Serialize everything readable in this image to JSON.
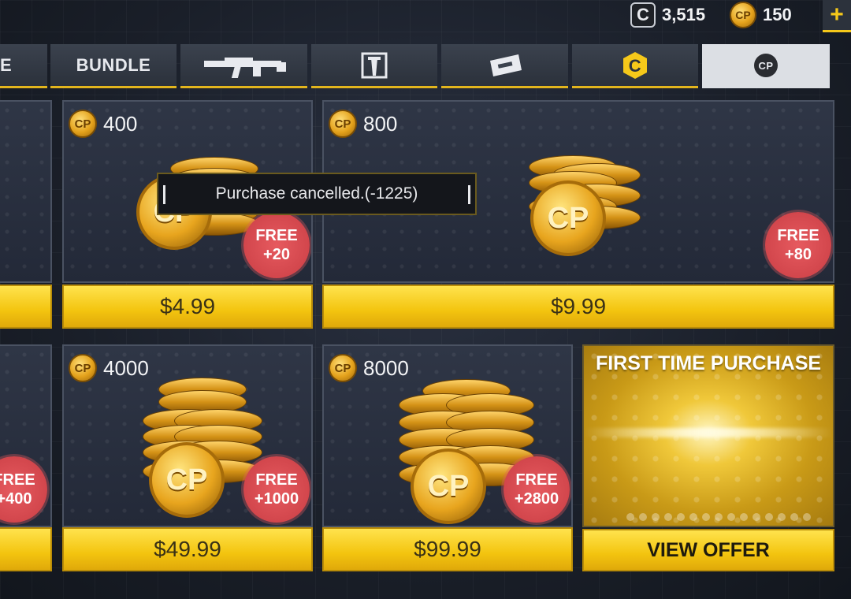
{
  "currency": {
    "c_icon_label": "C",
    "c_value": "3,515",
    "cp_icon_label": "CP",
    "cp_value": "150",
    "add_label": "+"
  },
  "tabs": [
    {
      "label": "E"
    },
    {
      "label": "BUNDLE"
    },
    {
      "icon": "rifle-icon"
    },
    {
      "icon": "character-icon"
    },
    {
      "icon": "ticket-icon"
    },
    {
      "icon": "c-credits-icon",
      "label": "C"
    },
    {
      "icon": "cp-icon",
      "label": "CP",
      "active": true
    }
  ],
  "items": [
    {
      "amount": "400",
      "bonus_top": "FREE",
      "bonus_bottom": "+20",
      "price": "$4.99"
    },
    {
      "amount": "800",
      "bonus_top": "FREE",
      "bonus_bottom": "+80",
      "price": "$9.99"
    },
    {
      "amount": "4000",
      "bonus_top": "FREE",
      "bonus_bottom": "+1000",
      "price": "$49.99"
    },
    {
      "amount": "8000",
      "bonus_top": "FREE",
      "bonus_bottom": "+2800",
      "price": "$99.99"
    },
    {
      "bonus_top": "FREE",
      "bonus_bottom": "+400"
    }
  ],
  "offer": {
    "title": "FIRST TIME PURCHASE",
    "button": "VIEW OFFER"
  },
  "coin_label": "CP",
  "toast": "Purchase cancelled.(-1225)",
  "colors": {
    "accent": "#f3c40f",
    "badge": "#d2464c"
  }
}
